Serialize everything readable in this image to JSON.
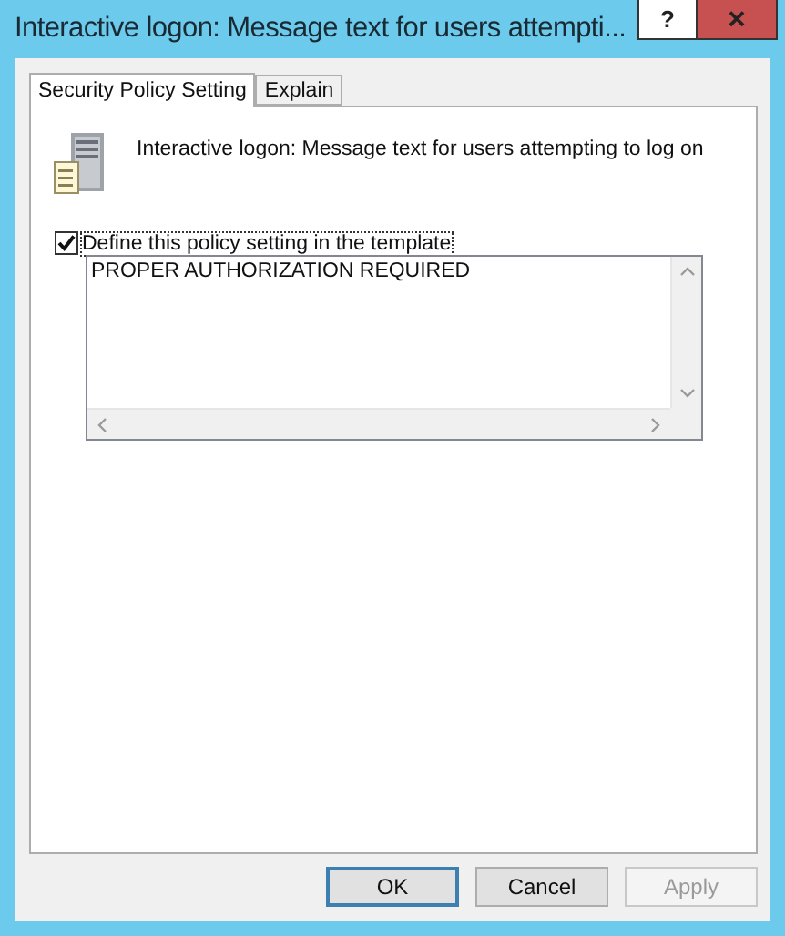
{
  "window": {
    "title": "Interactive logon: Message text for users attempti...",
    "help_button": "?",
    "close_button": "×"
  },
  "tabs": [
    {
      "label": "Security Policy Setting",
      "selected": true
    },
    {
      "label": "Explain",
      "selected": false
    }
  ],
  "policy": {
    "name": "Interactive logon: Message text for users attempting to log on"
  },
  "define_checkbox": {
    "label": "Define this policy setting in the template",
    "checked": true
  },
  "message_text": {
    "value": "PROPER AUTHORIZATION REQUIRED"
  },
  "buttons": [
    {
      "label": "OK",
      "default": true,
      "disabled": false
    },
    {
      "label": "Cancel",
      "default": false,
      "disabled": false
    },
    {
      "label": "Apply",
      "default": false,
      "disabled": true
    }
  ]
}
